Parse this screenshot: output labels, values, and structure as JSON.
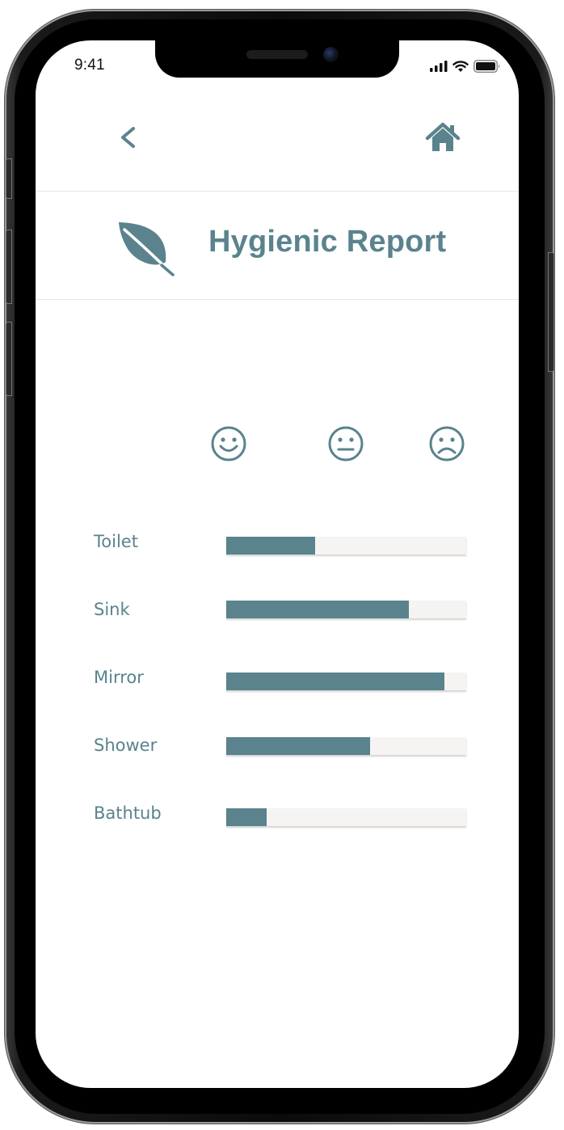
{
  "status_bar": {
    "time": "9:41"
  },
  "header": {
    "title": "Hygienic Report"
  },
  "icons": {
    "back": "chevron-left-icon",
    "home": "home-icon",
    "logo": "leaf-icon",
    "faces": [
      "smiling-face-icon",
      "neutral-face-icon",
      "frowning-face-icon"
    ]
  },
  "colors": {
    "accent": "#5a838d",
    "track": "#f5f4f2"
  },
  "report": {
    "items": [
      {
        "label": "Toilet",
        "value": 0.37
      },
      {
        "label": "Sink",
        "value": 0.76
      },
      {
        "label": "Mirror",
        "value": 0.91
      },
      {
        "label": "Shower",
        "value": 0.6
      },
      {
        "label": "Bathtub",
        "value": 0.17
      }
    ]
  }
}
